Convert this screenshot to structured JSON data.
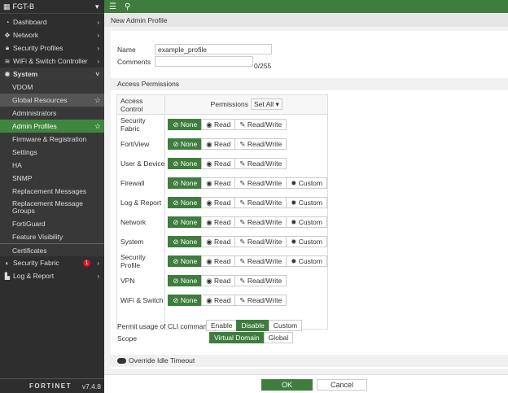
{
  "sidebar": {
    "device": "FGT-B",
    "items": [
      {
        "label": "Dashboard",
        "icon": "dashboard-icon"
      },
      {
        "label": "Network",
        "icon": "network-icon"
      },
      {
        "label": "Security Profiles",
        "icon": "lock-icon"
      },
      {
        "label": "WiFi & Switch Controller",
        "icon": "wifi-icon"
      }
    ],
    "system": "System",
    "sub": [
      "VDOM",
      "Global Resources",
      "Administrators",
      "Admin Profiles",
      "Firmware & Registration",
      "Settings",
      "HA",
      "SNMP",
      "Replacement Messages",
      "Replacement Message Groups",
      "FortiGuard",
      "Feature Visibility",
      "Certificates"
    ],
    "fabric": "Security Fabric",
    "fabric_badge": "1",
    "log": "Log & Report",
    "logo": "FORTINET",
    "version": "v7.4.8"
  },
  "page": {
    "title": "New Admin Profile",
    "name_label": "Name",
    "name_value": "example_profile",
    "comments_label": "Comments",
    "comments_count": "0/255",
    "access_title": "Access Permissions",
    "col_access": "Access Control",
    "col_perm": "Permissions",
    "set_all": "Set All",
    "none": "None",
    "read": "Read",
    "rw": "Read/Write",
    "custom": "Custom",
    "rows": [
      {
        "name": "Security Fabric",
        "custom": false
      },
      {
        "name": "FortiView",
        "custom": false
      },
      {
        "name": "User & Device",
        "custom": false
      },
      {
        "name": "Firewall",
        "custom": true
      },
      {
        "name": "Log & Report",
        "custom": true
      },
      {
        "name": "Network",
        "custom": true
      },
      {
        "name": "System",
        "custom": true
      },
      {
        "name": "Security Profile",
        "custom": true
      },
      {
        "name": "VPN",
        "custom": false
      },
      {
        "name": "WiFi & Switch",
        "custom": false
      }
    ],
    "cli_label": "Permit usage of CLI commands",
    "cli_opts": [
      "Enable",
      "Disable",
      "Custom"
    ],
    "cli_selected": "Disable",
    "scope_label": "Scope",
    "scope_opts": [
      "Virtual Domain",
      "Global"
    ],
    "scope_selected": "Virtual Domain",
    "idle": "Override Idle Timeout",
    "ok": "OK",
    "cancel": "Cancel"
  },
  "colors": {
    "accent": "#3e7d3e",
    "sidebar": "#2e2e2e"
  }
}
